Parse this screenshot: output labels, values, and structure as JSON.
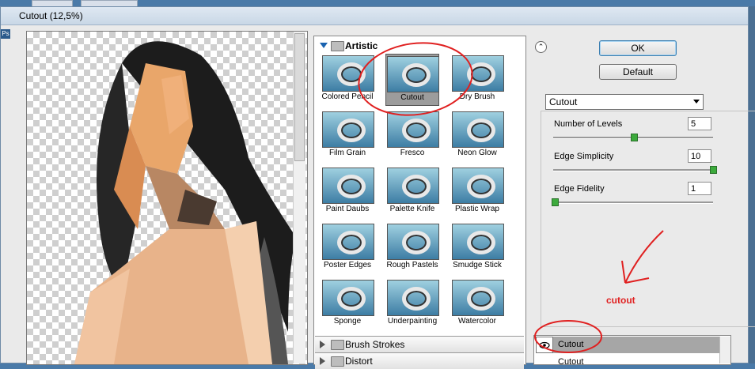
{
  "window": {
    "title": "Cutout (12,5%)"
  },
  "background": {
    "tabs": [
      "",
      ""
    ],
    "app_badge": "Ps"
  },
  "filter_gallery": {
    "category": "Artistic",
    "filters": [
      {
        "label": "Colored Pencil"
      },
      {
        "label": "Cutout"
      },
      {
        "label": "Dry Brush"
      },
      {
        "label": "Film Grain"
      },
      {
        "label": "Fresco"
      },
      {
        "label": "Neon Glow"
      },
      {
        "label": "Paint Daubs"
      },
      {
        "label": "Palette Knife"
      },
      {
        "label": "Plastic Wrap"
      },
      {
        "label": "Poster Edges"
      },
      {
        "label": "Rough Pastels"
      },
      {
        "label": "Smudge Stick"
      },
      {
        "label": "Sponge"
      },
      {
        "label": "Underpainting"
      },
      {
        "label": "Watercolor"
      }
    ],
    "selected": "Cutout",
    "other_categories": [
      "Brush Strokes",
      "Distort"
    ]
  },
  "buttons": {
    "ok": "OK",
    "default": "Default"
  },
  "filter_select": {
    "value": "Cutout"
  },
  "params": [
    {
      "label": "Number of Levels",
      "value": "5",
      "level": 0.5
    },
    {
      "label": "Edge Simplicity",
      "value": "10",
      "level": 1.0
    },
    {
      "label": "Edge Fidelity",
      "value": "1",
      "level": 0.0
    }
  ],
  "effect_layers": [
    "Cutout",
    "Cutout"
  ],
  "annotation": {
    "text": "cutout",
    "color": "#e02020"
  },
  "colors": {
    "accent": "#1a63b0",
    "slider": "#3caa3c",
    "annotation": "#e02020"
  }
}
